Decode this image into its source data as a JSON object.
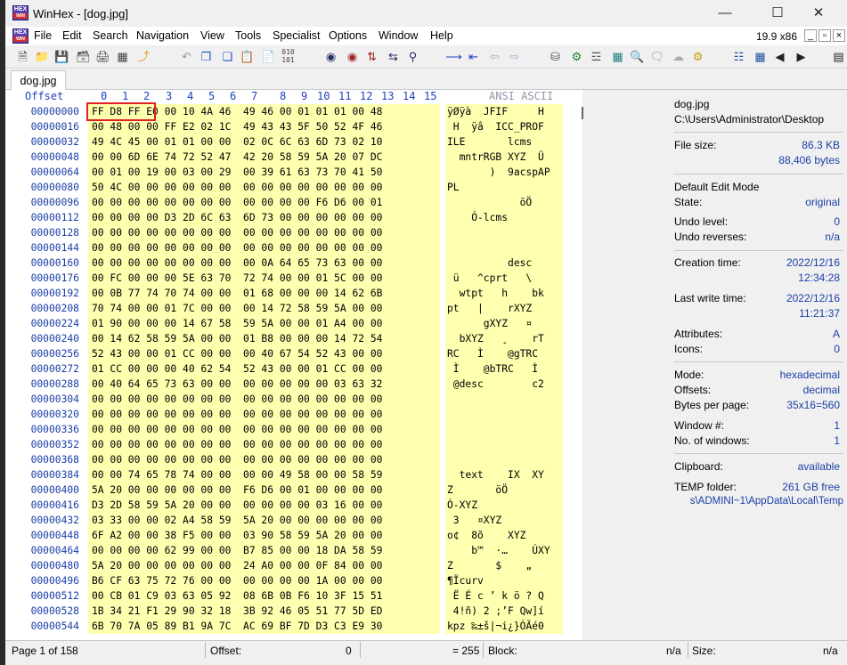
{
  "window": {
    "app": "WinHex",
    "title": "WinHex - [dog.jpg]",
    "version": "19.9 x86"
  },
  "menu": [
    "File",
    "Edit",
    "Search",
    "Navigation",
    "View",
    "Tools",
    "Specialist",
    "Options",
    "Window",
    "Help"
  ],
  "tab": {
    "label": "dog.jpg"
  },
  "columns": {
    "offset_label": "Offset",
    "ansi_label": "ANSI ASCII",
    "hex_cols": [
      "0",
      "1",
      "2",
      "3",
      "4",
      "5",
      "6",
      "7",
      "8",
      "9",
      "10",
      "11",
      "12",
      "13",
      "14",
      "15"
    ]
  },
  "rows": [
    {
      "offset": "00000000",
      "hex": "FF D8 FF E0 00 10 4A 46  49 46 00 01 01 01 00 48",
      "ascii": "ÿØÿà  JFIF     H"
    },
    {
      "offset": "00000016",
      "hex": "00 48 00 00 FF E2 02 1C  49 43 43 5F 50 52 4F 46",
      "ascii": " H  ÿâ  ICC_PROF"
    },
    {
      "offset": "00000032",
      "hex": "49 4C 45 00 01 01 00 00  02 0C 6C 63 6D 73 02 10",
      "ascii": "ILE       lcms  "
    },
    {
      "offset": "00000048",
      "hex": "00 00 6D 6E 74 72 52 47  42 20 58 59 5A 20 07 DC",
      "ascii": "  mntrRGB XYZ  Ü"
    },
    {
      "offset": "00000064",
      "hex": "00 01 00 19 00 03 00 29  00 39 61 63 73 70 41 50",
      "ascii": "       )  9acspAP"
    },
    {
      "offset": "00000080",
      "hex": "50 4C 00 00 00 00 00 00  00 00 00 00 00 00 00 00",
      "ascii": "PL              "
    },
    {
      "offset": "00000096",
      "hex": "00 00 00 00 00 00 00 00  00 00 00 00 F6 D6 00 01",
      "ascii": "            öÖ  "
    },
    {
      "offset": "00000112",
      "hex": "00 00 00 00 D3 2D 6C 63  6D 73 00 00 00 00 00 00",
      "ascii": "    Ó-lcms      "
    },
    {
      "offset": "00000128",
      "hex": "00 00 00 00 00 00 00 00  00 00 00 00 00 00 00 00",
      "ascii": "                "
    },
    {
      "offset": "00000144",
      "hex": "00 00 00 00 00 00 00 00  00 00 00 00 00 00 00 00",
      "ascii": "                "
    },
    {
      "offset": "00000160",
      "hex": "00 00 00 00 00 00 00 00  00 0A 64 65 73 63 00 00",
      "ascii": "          desc  "
    },
    {
      "offset": "00000176",
      "hex": "00 FC 00 00 00 5E 63 70  72 74 00 00 01 5C 00 00",
      "ascii": " ü   ^cprt   \\  "
    },
    {
      "offset": "00000192",
      "hex": "00 0B 77 74 70 74 00 00  01 68 00 00 00 14 62 6B",
      "ascii": "  wtpt   h    bk"
    },
    {
      "offset": "00000208",
      "hex": "70 74 00 00 01 7C 00 00  00 14 72 58 59 5A 00 00",
      "ascii": "pt   |    rXYZ  "
    },
    {
      "offset": "00000224",
      "hex": "01 90 00 00 00 14 67 58  59 5A 00 00 01 A4 00 00",
      "ascii": "      gXYZ   ¤  "
    },
    {
      "offset": "00000240",
      "hex": "00 14 62 58 59 5A 00 00  01 B8 00 00 00 14 72 54",
      "ascii": "  bXYZ   ¸    rT"
    },
    {
      "offset": "00000256",
      "hex": "52 43 00 00 01 CC 00 00  00 40 67 54 52 43 00 00",
      "ascii": "RC   Ì    @gTRC  "
    },
    {
      "offset": "00000272",
      "hex": "01 CC 00 00 00 40 62 54  52 43 00 00 01 CC 00 00",
      "ascii": " Ì    @bTRC   Ì  "
    },
    {
      "offset": "00000288",
      "hex": "00 40 64 65 73 63 00 00  00 00 00 00 00 03 63 32",
      "ascii": " @desc        c2"
    },
    {
      "offset": "00000304",
      "hex": "00 00 00 00 00 00 00 00  00 00 00 00 00 00 00 00",
      "ascii": "                "
    },
    {
      "offset": "00000320",
      "hex": "00 00 00 00 00 00 00 00  00 00 00 00 00 00 00 00",
      "ascii": "                "
    },
    {
      "offset": "00000336",
      "hex": "00 00 00 00 00 00 00 00  00 00 00 00 00 00 00 00",
      "ascii": "                "
    },
    {
      "offset": "00000352",
      "hex": "00 00 00 00 00 00 00 00  00 00 00 00 00 00 00 00",
      "ascii": "                "
    },
    {
      "offset": "00000368",
      "hex": "00 00 00 00 00 00 00 00  00 00 00 00 00 00 00 00",
      "ascii": "                "
    },
    {
      "offset": "00000384",
      "hex": "00 00 74 65 78 74 00 00  00 00 49 58 00 00 58 59",
      "ascii": "  text    IX  XY"
    },
    {
      "offset": "00000400",
      "hex": "5A 20 00 00 00 00 00 00  F6 D6 00 01 00 00 00 00",
      "ascii": "Z       öÖ      "
    },
    {
      "offset": "00000416",
      "hex": "D3 2D 58 59 5A 20 00 00  00 00 00 00 03 16 00 00",
      "ascii": "Ó-XYZ           "
    },
    {
      "offset": "00000432",
      "hex": "03 33 00 00 02 A4 58 59  5A 20 00 00 00 00 00 00",
      "ascii": " 3   ¤XYZ       "
    },
    {
      "offset": "00000448",
      "hex": "6F A2 00 00 38 F5 00 00  03 90 58 59 5A 20 00 00",
      "ascii": "o¢  8õ    XYZ   "
    },
    {
      "offset": "00000464",
      "hex": "00 00 00 00 62 99 00 00  B7 85 00 00 18 DA 58 59",
      "ascii": "    b™  ·…    ÚXY"
    },
    {
      "offset": "00000480",
      "hex": "5A 20 00 00 00 00 00 00  24 A0 00 00 0F 84 00 00",
      "ascii": "Z       $    „  "
    },
    {
      "offset": "00000496",
      "hex": "B6 CF 63 75 72 76 00 00  00 00 00 00 1A 00 00 00",
      "ascii": "¶Ïcurv          "
    },
    {
      "offset": "00000512",
      "hex": "00 CB 01 C9 03 63 05 92  08 6B 0B F6 10 3F 15 51",
      "ascii": " Ë É c ’ k ö ? Q"
    },
    {
      "offset": "00000528",
      "hex": "1B 34 21 F1 29 90 32 18  3B 92 46 05 51 77 5D ED",
      "ascii": " 4!ñ) 2 ;’F Qw]í"
    },
    {
      "offset": "00000544",
      "hex": "6B 70 7A 05 89 B1 9A 7C  AC 69 BF 7D D3 C3 E9 30",
      "ascii": "kpz ‰±š|¬i¿}ÓÃé0"
    }
  ],
  "info": {
    "filename": "dog.jpg",
    "path": "C:\\Users\\Administrator\\Desktop",
    "filesize_label": "File size:",
    "filesize_kb": "86.3 KB",
    "filesize_bytes": "88,406 bytes",
    "edit_mode": "Default Edit Mode",
    "state_label": "State:",
    "state": "original",
    "undo_level_label": "Undo level:",
    "undo_level": "0",
    "undo_rev_label": "Undo reverses:",
    "undo_rev": "n/a",
    "ctime_label": "Creation time:",
    "ctime_date": "2022/12/16",
    "ctime_time": "12:34:28",
    "wtime_label": "Last write time:",
    "wtime_date": "2022/12/16",
    "wtime_time": "11:21:37",
    "attr_label": "Attributes:",
    "attr": "A",
    "icons_label": "Icons:",
    "icons": "0",
    "mode_label": "Mode:",
    "mode": "hexadecimal",
    "offsets_label": "Offsets:",
    "offsets": "decimal",
    "bpp_label": "Bytes per page:",
    "bpp": "35x16=560",
    "win_label": "Window #:",
    "win": "1",
    "nwin_label": "No. of windows:",
    "nwin": "1",
    "clip_label": "Clipboard:",
    "clip": "available",
    "temp_label": "TEMP folder:",
    "temp_free": "261 GB free",
    "temp_path": "s\\ADMINI~1\\AppData\\Local\\Temp"
  },
  "status": {
    "page": "Page 1 of 158",
    "offset_label": "Offset:",
    "offset": "0",
    "sel": "= 255",
    "block_label": "Block:",
    "block": "n/a",
    "size_label": "Size:",
    "size": "n/a"
  },
  "colors": {
    "hex_bg": "#ffffb0",
    "offset_fg": "#1a3ea8",
    "highlight": "#e02020"
  }
}
